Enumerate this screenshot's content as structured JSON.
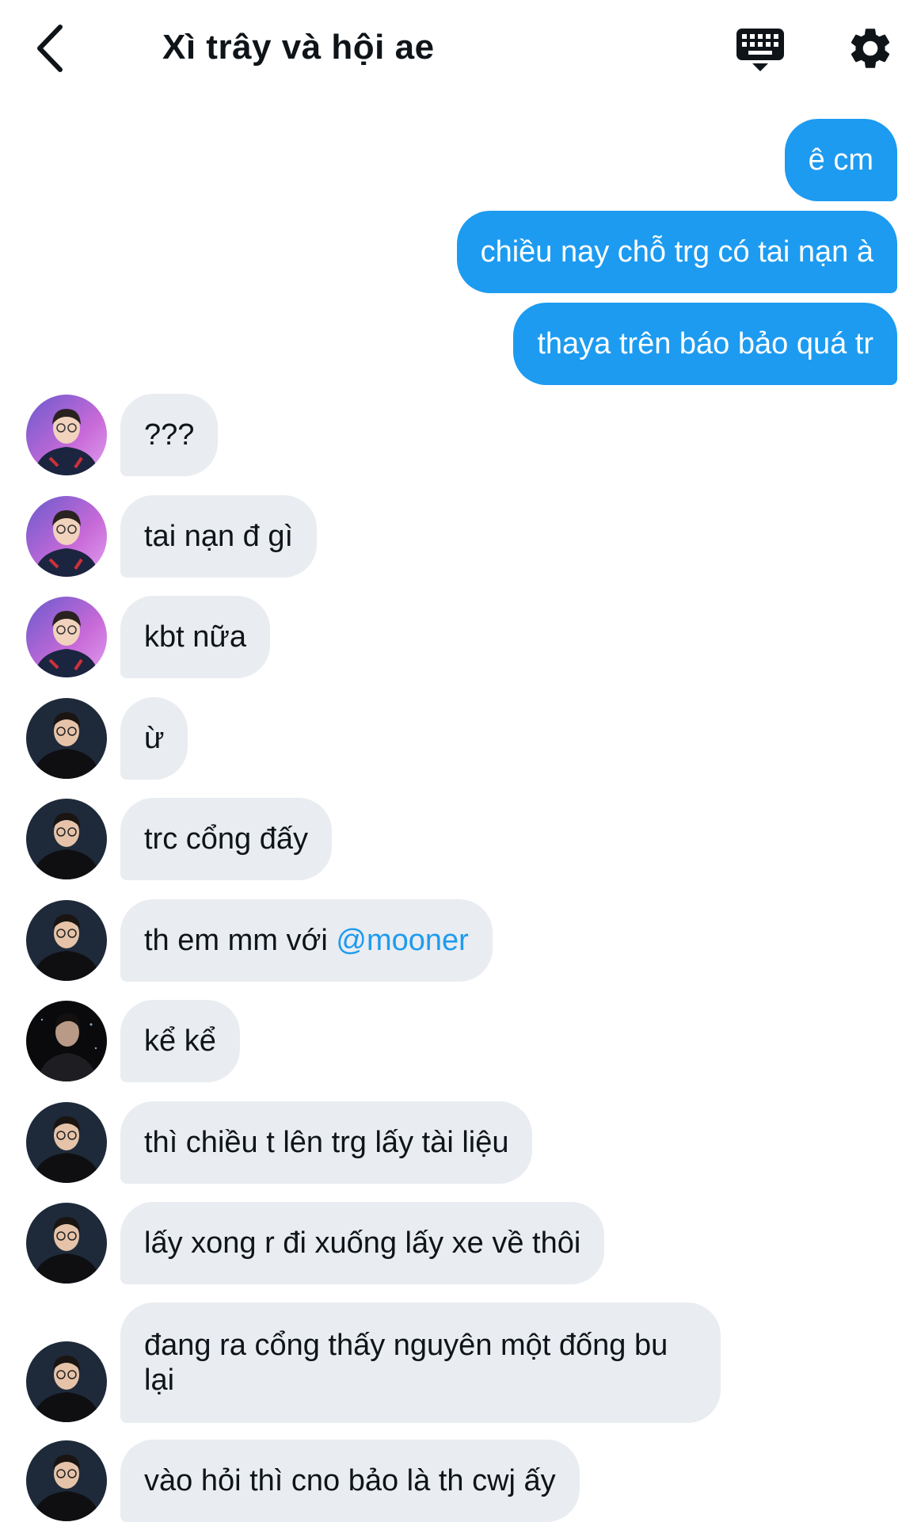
{
  "header": {
    "title": "Xì trây và hội ae"
  },
  "icons": {
    "back": "chevron-left-icon",
    "keyboard": "keyboard-icon",
    "settings": "gear-icon"
  },
  "colors": {
    "outgoing_bubble": "#1d9bf0",
    "incoming_bubble": "#e9ecf0",
    "mention": "#1d9bf0"
  },
  "messages": [
    {
      "side": "out",
      "text": "ê cm"
    },
    {
      "side": "out",
      "text": "chiều nay chỗ trg có tai nạn à"
    },
    {
      "side": "out",
      "text": "thaya trên báo bảo quá tr"
    },
    {
      "side": "in",
      "text": "???"
    },
    {
      "side": "in",
      "text": "tai nạn đ gì"
    },
    {
      "side": "in",
      "text": "kbt nữa"
    },
    {
      "side": "in",
      "text": "ừ"
    },
    {
      "side": "in",
      "text": "trc cổng đấy"
    },
    {
      "side": "in",
      "text": "th em mm với ",
      "mention": "@mooner"
    },
    {
      "side": "in",
      "text": "kể kể"
    },
    {
      "side": "in",
      "text": "thì chiều t lên trg lấy tài liệu"
    },
    {
      "side": "in",
      "text": "lấy xong r đi xuống lấy xe về thôi"
    },
    {
      "side": "in",
      "text": "đang ra cổng thấy nguyên một đống bu lại"
    },
    {
      "side": "in",
      "text": "vào hỏi thì cno bảo là th cwj ấy"
    }
  ]
}
